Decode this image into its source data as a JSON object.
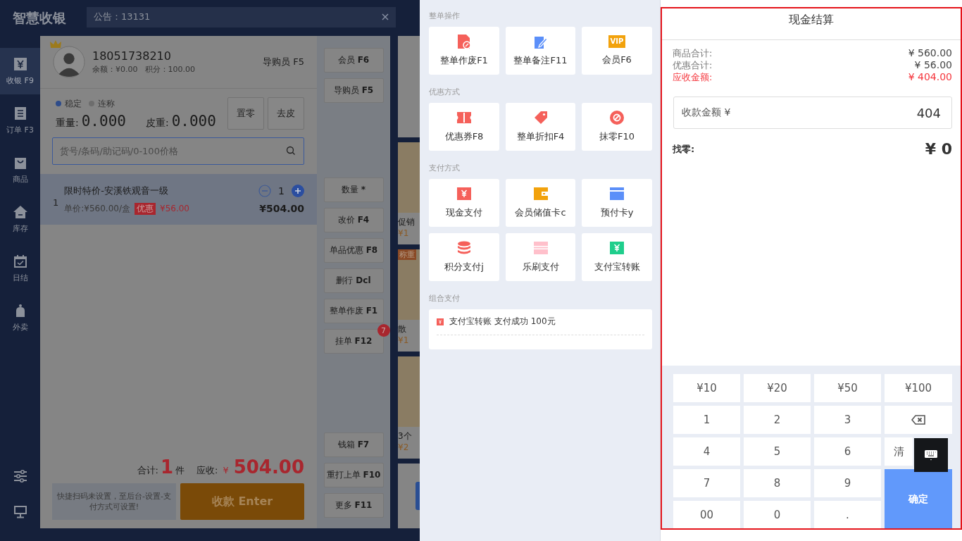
{
  "app": {
    "logo": "智慧收银",
    "notice": "公告：13131"
  },
  "sidebar": {
    "items": [
      {
        "label": "收银 F9",
        "selected": true
      },
      {
        "label": "订单 F3",
        "selected": false
      },
      {
        "label": "商品",
        "selected": false
      },
      {
        "label": "库存",
        "selected": false
      },
      {
        "label": "日结",
        "selected": false
      },
      {
        "label": "外卖",
        "selected": false
      }
    ]
  },
  "member": {
    "phone": "18051738210",
    "balance": "余额：¥0.00",
    "points": "积分：100.00",
    "guide": "导购员 F5"
  },
  "scale": {
    "modes": [
      {
        "label": "稳定",
        "on": true
      },
      {
        "label": "连称",
        "on": false
      }
    ],
    "weight_label": "重量:",
    "weight": "0.000",
    "tare_label": "皮重:",
    "tare": "0.000",
    "buttons": [
      "置零",
      "去皮"
    ]
  },
  "search": {
    "placeholder": "货号/条码/助记码/0-100价格"
  },
  "cart": [
    {
      "index": "1",
      "name": "限时特价-安溪铁观音一级",
      "qty": "1",
      "unit_price": "单价:¥560.00/盒",
      "tag": "优惠",
      "discount": "¥56.00",
      "total": "¥504.00",
      "selected": true
    }
  ],
  "summary": {
    "count_label": "合计:",
    "count": "1",
    "unit": "件",
    "due_label": "应收:",
    "currency": "¥",
    "due": "504.00"
  },
  "quick_scan_note": "快捷扫码未设置，至后台-设置-支付方式可设置!",
  "pay_button": "收款 Enter",
  "function_buttons": {
    "top": [
      {
        "label": "会员",
        "key": "F6"
      },
      {
        "label": "导购员",
        "key": "F5"
      }
    ],
    "middle": [
      {
        "label": "数量",
        "key": "*"
      },
      {
        "label": "改价",
        "key": "F4"
      },
      {
        "label": "单品优惠",
        "key": "F8"
      },
      {
        "label": "删行",
        "key": "Dcl"
      },
      {
        "label": "整单作废",
        "key": "F1"
      },
      {
        "label": "挂单",
        "key": "F12",
        "badge": "7"
      }
    ],
    "bottom": [
      {
        "label": "钱箱",
        "key": "F7"
      },
      {
        "label": "重打上单",
        "key": "F10"
      },
      {
        "label": "更多",
        "key": "F11"
      }
    ]
  },
  "products": [
    {
      "name": "促销",
      "price": "¥1"
    },
    {
      "tag": "称重",
      "name": "散",
      "price": "¥1"
    },
    {
      "name": "3个",
      "price": "¥2"
    }
  ],
  "operations": [
    {
      "title": "整单操作",
      "items": [
        {
          "label": "整单作废F1"
        },
        {
          "label": "整单备注F11"
        },
        {
          "label": "会员F6",
          "icon_text": "VIP"
        }
      ]
    },
    {
      "title": "优惠方式",
      "items": [
        {
          "label": "优惠券F8"
        },
        {
          "label": "整单折扣F4"
        },
        {
          "label": "抹零F10"
        }
      ]
    },
    {
      "title": "支付方式",
      "items": [
        {
          "label": "现金支付"
        },
        {
          "label": "会员储值卡c"
        },
        {
          "label": "预付卡y"
        },
        {
          "label": "积分支付j"
        },
        {
          "label": "乐刷支付"
        },
        {
          "label": "支付宝转账"
        }
      ]
    }
  ],
  "combo_payment": {
    "title": "组合支付",
    "entries": [
      {
        "text": "支付宝转账 支付成功 100元"
      }
    ]
  },
  "checkout": {
    "title": "现金结算",
    "totals": [
      {
        "label": "商品合计:",
        "value": "¥ 560.00",
        "kind": "normal"
      },
      {
        "label": "优惠合计:",
        "value": "¥ 56.00",
        "kind": "normal"
      },
      {
        "label": "应收金额:",
        "value": "¥ 404.00",
        "kind": "due"
      }
    ],
    "received": {
      "label": "收款金额 ¥",
      "value": "404"
    },
    "change": {
      "label": "找零:",
      "value": "¥ 0"
    },
    "keypad": [
      {
        "label": "¥10",
        "kind": "key"
      },
      {
        "label": "¥20",
        "kind": "key"
      },
      {
        "label": "¥50",
        "kind": "key"
      },
      {
        "label": "¥100",
        "kind": "key"
      },
      {
        "label": "1",
        "kind": "key"
      },
      {
        "label": "2",
        "kind": "key"
      },
      {
        "label": "3",
        "kind": "key"
      },
      {
        "kind": "backspace"
      },
      {
        "label": "4",
        "kind": "key"
      },
      {
        "label": "5",
        "kind": "key"
      },
      {
        "label": "6",
        "kind": "key"
      },
      {
        "label": "清",
        "kind": "key"
      },
      {
        "label": "7",
        "kind": "key"
      },
      {
        "label": "8",
        "kind": "key"
      },
      {
        "label": "9",
        "kind": "key"
      },
      {
        "label": "确定",
        "kind": "confirm"
      },
      {
        "label": "00",
        "kind": "key"
      },
      {
        "label": "0",
        "kind": "key"
      },
      {
        "label": ".",
        "kind": "key"
      }
    ]
  }
}
